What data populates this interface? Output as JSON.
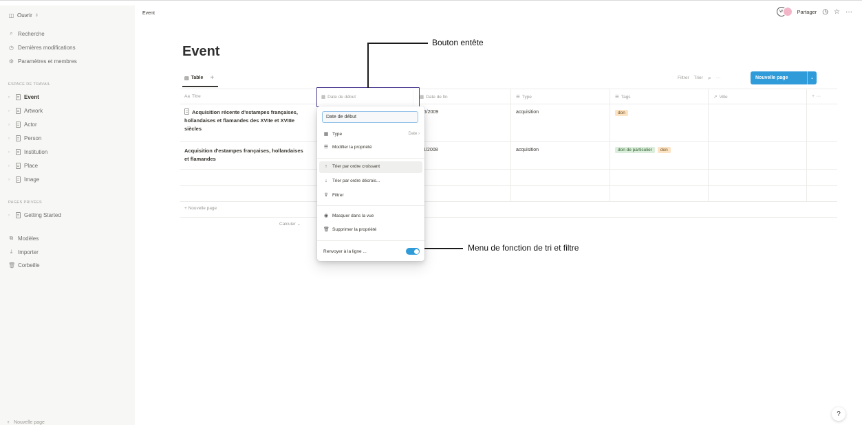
{
  "workspace": {
    "name": "Ouvrir"
  },
  "sidebar": {
    "top_items": [
      {
        "label": "Recherche",
        "icon": "search-icon"
      },
      {
        "label": "Dernières modifications",
        "icon": "clock-icon"
      },
      {
        "label": "Paramètres et membres",
        "icon": "gear-icon"
      }
    ],
    "section_workspace": "ESPACE DE TRAVAIL",
    "pages": [
      {
        "label": "Event",
        "active": true
      },
      {
        "label": "Artwork"
      },
      {
        "label": "Actor"
      },
      {
        "label": "Person"
      },
      {
        "label": "Institution"
      },
      {
        "label": "Place"
      },
      {
        "label": "Image"
      }
    ],
    "section_private": "PAGES PRIVÉES",
    "private_pages": [
      {
        "label": "Getting Started"
      }
    ],
    "tools": [
      {
        "label": "Modèles",
        "icon": "templates-icon"
      },
      {
        "label": "Importer",
        "icon": "import-icon"
      },
      {
        "label": "Corbeille",
        "icon": "trash-icon"
      }
    ],
    "new_page": "Nouvelle page"
  },
  "topbar": {
    "breadcrumb": "Event",
    "avatar_initials": "W",
    "share": "Partager"
  },
  "page": {
    "title": "Event",
    "view_tab": "Table",
    "toolbar": {
      "filter": "Filtrer",
      "sort": "Trier",
      "new_page": "Nouvelle page"
    }
  },
  "table": {
    "headers": [
      "Titre",
      "Date de début",
      "Date de fin",
      "Type",
      "Tags",
      "Ville"
    ],
    "rows": [
      {
        "title": "Acquisition récente d'estampes françaises, hollandaises et flamandes des XVIIe et XVIIIe siècles",
        "date_end": "6/06/2009",
        "type": "acquisition",
        "tags": [
          "don"
        ]
      },
      {
        "title": "Acquisition d'estampes françaises, hollandaises et flamandes",
        "date_end": "8/11/2008",
        "type": "acquisition",
        "tags": [
          "don de particulier",
          "don"
        ]
      }
    ],
    "new_row": "+ Nouvelle page",
    "calculate": "Calculer"
  },
  "menu": {
    "input_value": "Date de début",
    "items": [
      {
        "label": "Type",
        "right": "Date",
        "icon": "calendar-icon"
      },
      {
        "label": "Modifier la propriété",
        "icon": "edit-list-icon"
      },
      {
        "label": "Trier par ordre croissant",
        "icon": "arrow-up-icon"
      },
      {
        "label": "Trier par ordre décrois...",
        "icon": "arrow-down-icon"
      },
      {
        "label": "Filtrer",
        "icon": "filter-icon"
      },
      {
        "label": "Masquer dans la vue",
        "icon": "eye-icon"
      },
      {
        "label": "Supprimer la propriété",
        "icon": "trash-icon"
      },
      {
        "label": "Renvoyer à la ligne ...",
        "icon": "wrap-icon"
      }
    ]
  },
  "annotations": {
    "header_button": "Bouton entête",
    "menu_label": "Menu de fonction de tri et filtre"
  },
  "help": "?"
}
